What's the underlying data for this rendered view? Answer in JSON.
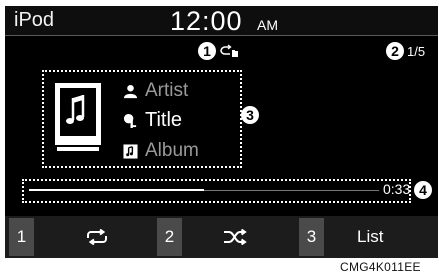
{
  "status": {
    "source": "iPod",
    "clock": "12:00",
    "ampm": "AM"
  },
  "callouts": [
    "1",
    "2",
    "3",
    "4"
  ],
  "track": {
    "position": "1/5",
    "artist": "Artist",
    "title": "Title",
    "album": "Album",
    "elapsed": "0:33",
    "progress": 0.5
  },
  "buttons": {
    "preset1": "1",
    "preset2": "2",
    "preset3": "3",
    "list": "List"
  },
  "icons": {
    "repeat_status": "repeat-one-folder-icon",
    "album_art": "music-note-icon",
    "artist": "person-icon",
    "title": "music-title-icon",
    "album": "album-icon",
    "repeat": "repeat-icon",
    "shuffle": "shuffle-icon"
  },
  "caption": "CMG4K011EE",
  "colors": {
    "background": "#000000",
    "text": "#ffffff",
    "dim_text": "#9a9a9a",
    "button": "#4a4a4a"
  }
}
